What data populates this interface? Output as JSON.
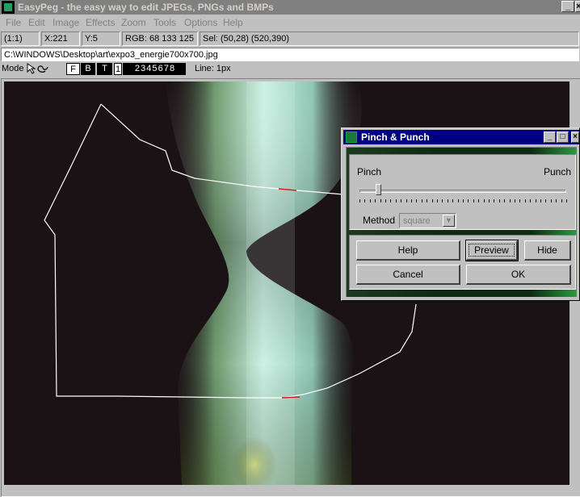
{
  "window": {
    "title": "EasyPeg - the easy way to edit JPEGs, PNGs and BMPs",
    "minimize": "_",
    "close": "×"
  },
  "menu": [
    "File",
    "Edit",
    "Image",
    "Effects",
    "Zoom",
    "Tools",
    "Options",
    "Help"
  ],
  "status": {
    "zoom": "(1:1)",
    "x": "X:221",
    "y": "Y:5",
    "rgb": "RGB: 68 133 125",
    "selection": "Sel: (50,28) (520,390)"
  },
  "path": "C:\\WINDOWS\\Desktop\\art\\expo3_energie700x700.jpg",
  "modebar": {
    "mode_label": "Mode",
    "mode_buttons": [
      "F",
      "B",
      "T"
    ],
    "line_numbers": "1",
    "more_numbers": "2 3 4 5 6 7 8",
    "line_label": "Line: 1px"
  },
  "dialog": {
    "title": "Pinch & Punch",
    "buttons": {
      "min": "_",
      "max": "□",
      "close": "×"
    },
    "pinch_label": "Pinch",
    "punch_label": "Punch",
    "slider_value_fraction": 0.08,
    "method_label": "Method",
    "method_value": "square",
    "help": "Help",
    "preview": "Preview",
    "hide": "Hide",
    "cancel": "Cancel",
    "ok": "OK"
  },
  "colors": {
    "titlebar_inactive": "#808080",
    "dialog_titlebar": "#000080",
    "image_background": "#1a1215",
    "glow": "#bfe8da"
  }
}
